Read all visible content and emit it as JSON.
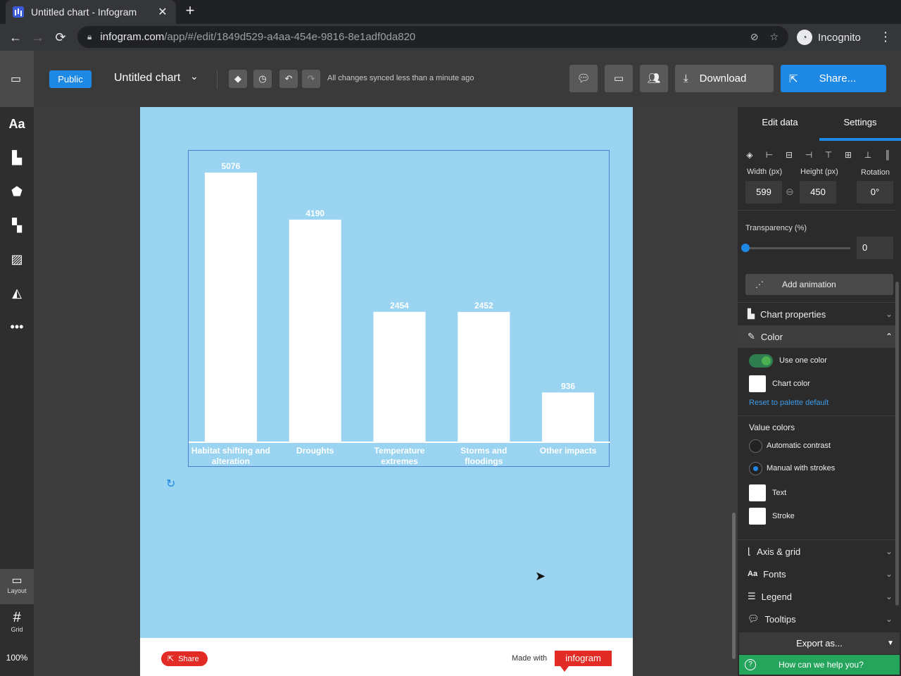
{
  "browser": {
    "tab_title": "Untitled chart - Infogram",
    "url_host": "infogram.com",
    "url_path": "/app/#/edit/1849d529-a4aa-454e-9816-8e1adf0da820",
    "profile_label": "Incognito"
  },
  "appbar": {
    "visibility_label": "Public",
    "chart_name": "Untitled chart",
    "sync_status": "All changes synced less than a minute ago",
    "download_label": "Download",
    "share_label": "Share..."
  },
  "leftbar": {
    "layout_label": "Layout",
    "grid_label": "Grid",
    "zoom": "100%"
  },
  "footer": {
    "share_label": "Share",
    "made_with": "Made with",
    "brand": "infogram"
  },
  "chart_data": {
    "type": "bar",
    "categories": [
      "Habitat shifting and alteration",
      "Droughts",
      "Temperature extremes",
      "Storms and floodings",
      "Other impacts"
    ],
    "category_lines": [
      [
        "Habitat shifting and",
        "alteration"
      ],
      [
        "Droughts"
      ],
      [
        "Temperature",
        "extremes"
      ],
      [
        "Storms and",
        "floodings"
      ],
      [
        "Other impacts"
      ]
    ],
    "values": [
      5076,
      4190,
      2454,
      2452,
      936
    ],
    "ylim": [
      0,
      5076
    ],
    "bar_color": "#ffffff",
    "label_color": "#ffffff",
    "background": "#9ad4f1",
    "grid": false
  },
  "panel": {
    "tabs": [
      "Edit data",
      "Settings"
    ],
    "active_tab": "Settings",
    "width_label": "Width (px)",
    "height_label": "Height (px)",
    "rotation_label": "Rotation",
    "width_value": "599",
    "height_value": "450",
    "rotation_value": "0°",
    "transparency_label": "Transparency (%)",
    "transparency_value": "0",
    "add_animation": "Add animation",
    "sections": {
      "chart_properties": "Chart properties",
      "color": "Color",
      "axis_grid": "Axis & grid",
      "fonts": "Fonts",
      "legend": "Legend",
      "tooltips": "Tooltips"
    },
    "use_one_color": "Use one color",
    "chart_color": "Chart color",
    "reset_palette": "Reset to palette default",
    "value_colors_title": "Value colors",
    "automatic_contrast": "Automatic contrast",
    "manual_strokes": "Manual with strokes",
    "text_label": "Text",
    "stroke_label": "Stroke",
    "export_label": "Export as...",
    "help_label": "How can we help you?",
    "accent_color": "#1e88e5"
  }
}
